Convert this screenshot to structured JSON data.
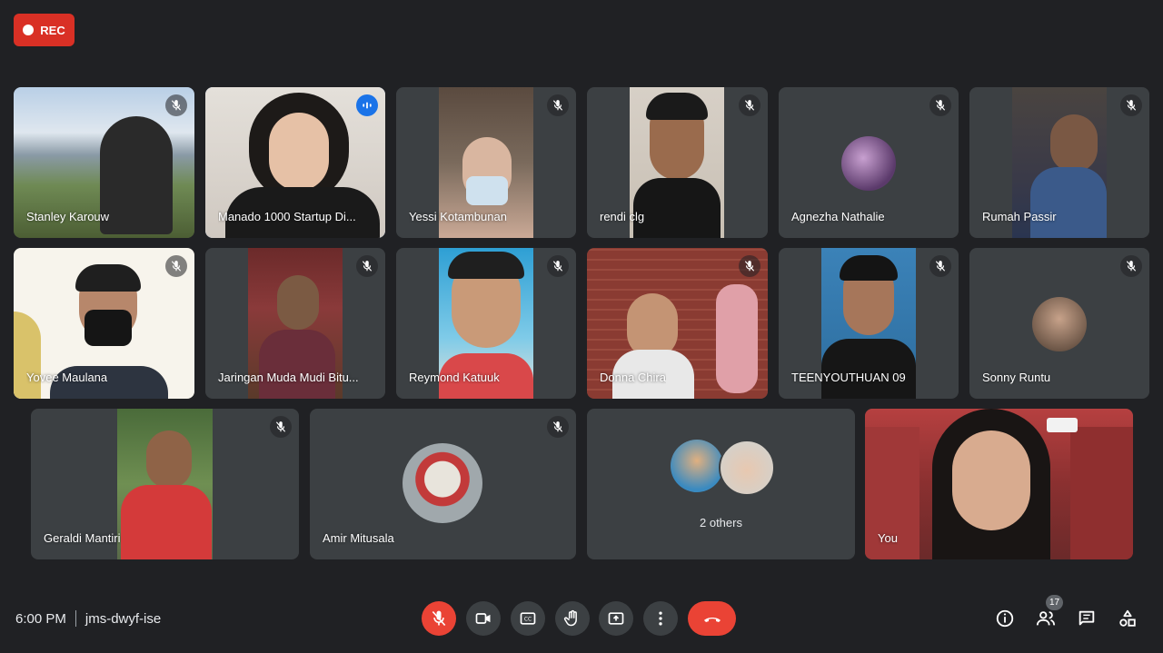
{
  "recording": {
    "label": "REC"
  },
  "meeting": {
    "time": "6:00 PM",
    "code": "jms-dwyf-ise"
  },
  "participants": [
    {
      "name": "Stanley Karouw"
    },
    {
      "name": "Manado 1000 Startup Di..."
    },
    {
      "name": "Yessi Kotambunan"
    },
    {
      "name": "rendi clg"
    },
    {
      "name": "Agnezha Nathalie"
    },
    {
      "name": "Rumah Passir"
    },
    {
      "name": "Yovee Maulana"
    },
    {
      "name": "Jaringan Muda Mudi Bitu..."
    },
    {
      "name": "Reymond Katuuk"
    },
    {
      "name": "Donna Chira"
    },
    {
      "name": "TEENYOUTHUAN 09"
    },
    {
      "name": "Sonny Runtu"
    },
    {
      "name": "Geraldi Mantiri"
    },
    {
      "name": "Amir Mitusala"
    },
    {
      "name": "You"
    }
  ],
  "others": {
    "label": "2 others"
  },
  "participant_count": "17",
  "colors": {
    "background": "#202124",
    "tile": "#3c4043",
    "hangup": "#ea4335",
    "speaking": "#8ab4f8"
  }
}
